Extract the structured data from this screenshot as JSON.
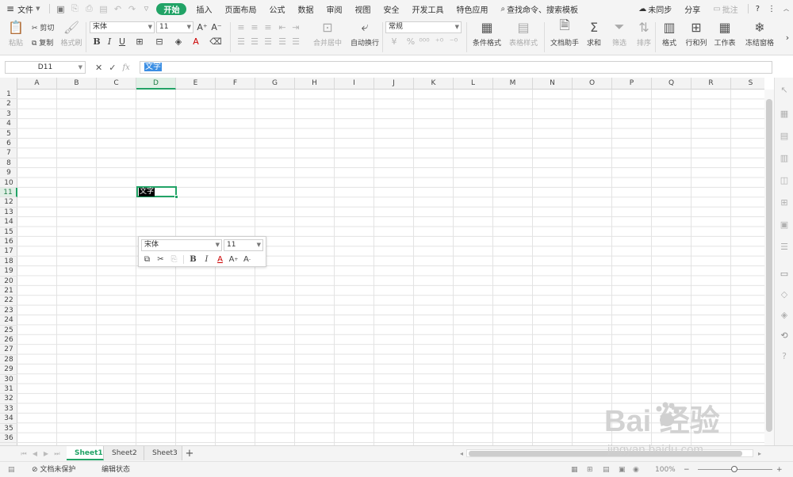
{
  "menu": {
    "hamburger_label": "文件",
    "items": [
      "开始",
      "插入",
      "页面布局",
      "公式",
      "数据",
      "审阅",
      "视图",
      "安全",
      "开发工具",
      "特色应用"
    ],
    "search_placeholder": "查找命令、搜索模板",
    "sync_label": "未同步",
    "share_label": "分享",
    "comment_label": "批注",
    "help_label": "?"
  },
  "ribbon": {
    "paste": "粘贴",
    "cut": "剪切",
    "copy": "复制",
    "format_painter": "格式刷",
    "font_name": "宋体",
    "font_size": "11",
    "merge_center": "合并居中",
    "wrap_text": "自动换行",
    "number_format": "常规",
    "conditional_format": "条件格式",
    "table_style": "表格样式",
    "doc_assistant": "文档助手",
    "sum": "求和",
    "filter": "筛选",
    "sort": "排序",
    "format": "格式",
    "rows_cols": "行和列",
    "worksheet": "工作表",
    "freeze": "冻结窗格"
  },
  "formula_bar": {
    "name_box": "D11",
    "fx": "fx",
    "content": "文字"
  },
  "columns": [
    "A",
    "B",
    "C",
    "D",
    "E",
    "F",
    "G",
    "H",
    "I",
    "J",
    "K",
    "L",
    "M",
    "N",
    "O",
    "P",
    "Q",
    "R",
    "S"
  ],
  "rows": [
    "1",
    "2",
    "3",
    "4",
    "5",
    "6",
    "7",
    "8",
    "9",
    "10",
    "11",
    "12",
    "13",
    "14",
    "15",
    "16",
    "17",
    "18",
    "19",
    "20",
    "21",
    "22",
    "23",
    "24",
    "25",
    "26",
    "27",
    "28",
    "29",
    "30",
    "31",
    "32",
    "33",
    "34",
    "35",
    "36"
  ],
  "active_cell": {
    "column": "D",
    "row": "11",
    "value": "文字"
  },
  "mini_toolbar": {
    "font_name": "宋体",
    "font_size": "11",
    "bold": "B",
    "italic": "I",
    "font_color": "A",
    "grow": "A",
    "shrink": "A"
  },
  "sheets": [
    "Sheet1",
    "Sheet2",
    "Sheet3"
  ],
  "active_sheet": "Sheet1",
  "status": {
    "protect": "文档未保护",
    "mode": "编辑状态",
    "zoom": "100%"
  },
  "watermark": {
    "brand": "Bai 经验",
    "url": "jingyan.baidu.com"
  },
  "colors": {
    "accent": "#21a366",
    "selection_blue": "#3b8ee3"
  }
}
